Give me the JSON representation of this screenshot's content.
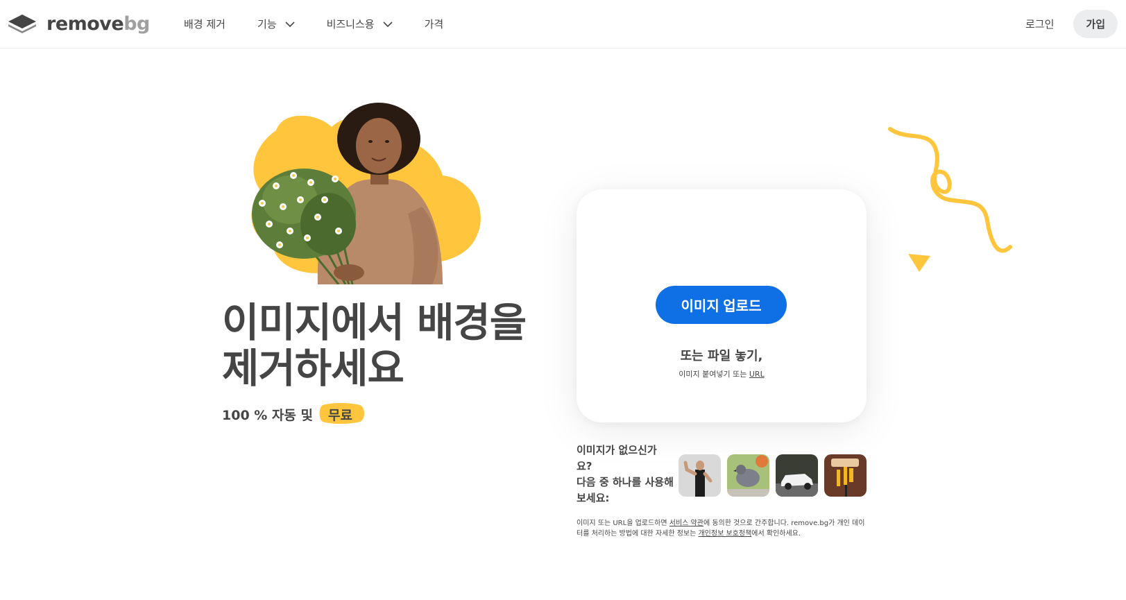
{
  "header": {
    "logo": {
      "word1": "remove",
      "word2": "bg",
      "icon": "layers-logo-icon"
    },
    "nav": [
      {
        "label": "배경 제거",
        "dropdown": false
      },
      {
        "label": "기능",
        "dropdown": true
      },
      {
        "label": "비즈니스용",
        "dropdown": true
      },
      {
        "label": "가격",
        "dropdown": false
      }
    ],
    "login_label": "로그인",
    "signup_label": "가입"
  },
  "hero": {
    "title_line1": "이미지에서 배경을",
    "title_line2": "제거하세요",
    "subtitle_prefix": "100 % 자동 및",
    "subtitle_highlight": "무료"
  },
  "upload": {
    "button_label": "이미지 업로드",
    "drop_text": "또는 파일 놓기,",
    "paste_prefix": "이미지 붙여넣기 또는",
    "paste_link": "URL"
  },
  "samples": {
    "label_line1": "이미지가 없으신가",
    "label_line2": "요?",
    "label_line3": "다음 중 하나를 사용해",
    "label_line4": "보세요:",
    "thumbnails": [
      "woman-flexing",
      "pigeon",
      "white-car",
      "paint-roller"
    ]
  },
  "legal": {
    "part1": "이미지 또는 URL을 업로드하면 ",
    "terms_link": "서비스 약관",
    "part2": "에 동의한 것으로 간주합니다. remove.bg가 개인 데이터를 처리하는 방법에 대한 자세한 정보는 ",
    "privacy_link": "개인정보 보호정책",
    "part3": "에서 확인하세요."
  },
  "colors": {
    "accent": "#0f70e6",
    "yellow": "#ffc53d",
    "text": "#454545",
    "signup_bg": "#ecedef"
  }
}
